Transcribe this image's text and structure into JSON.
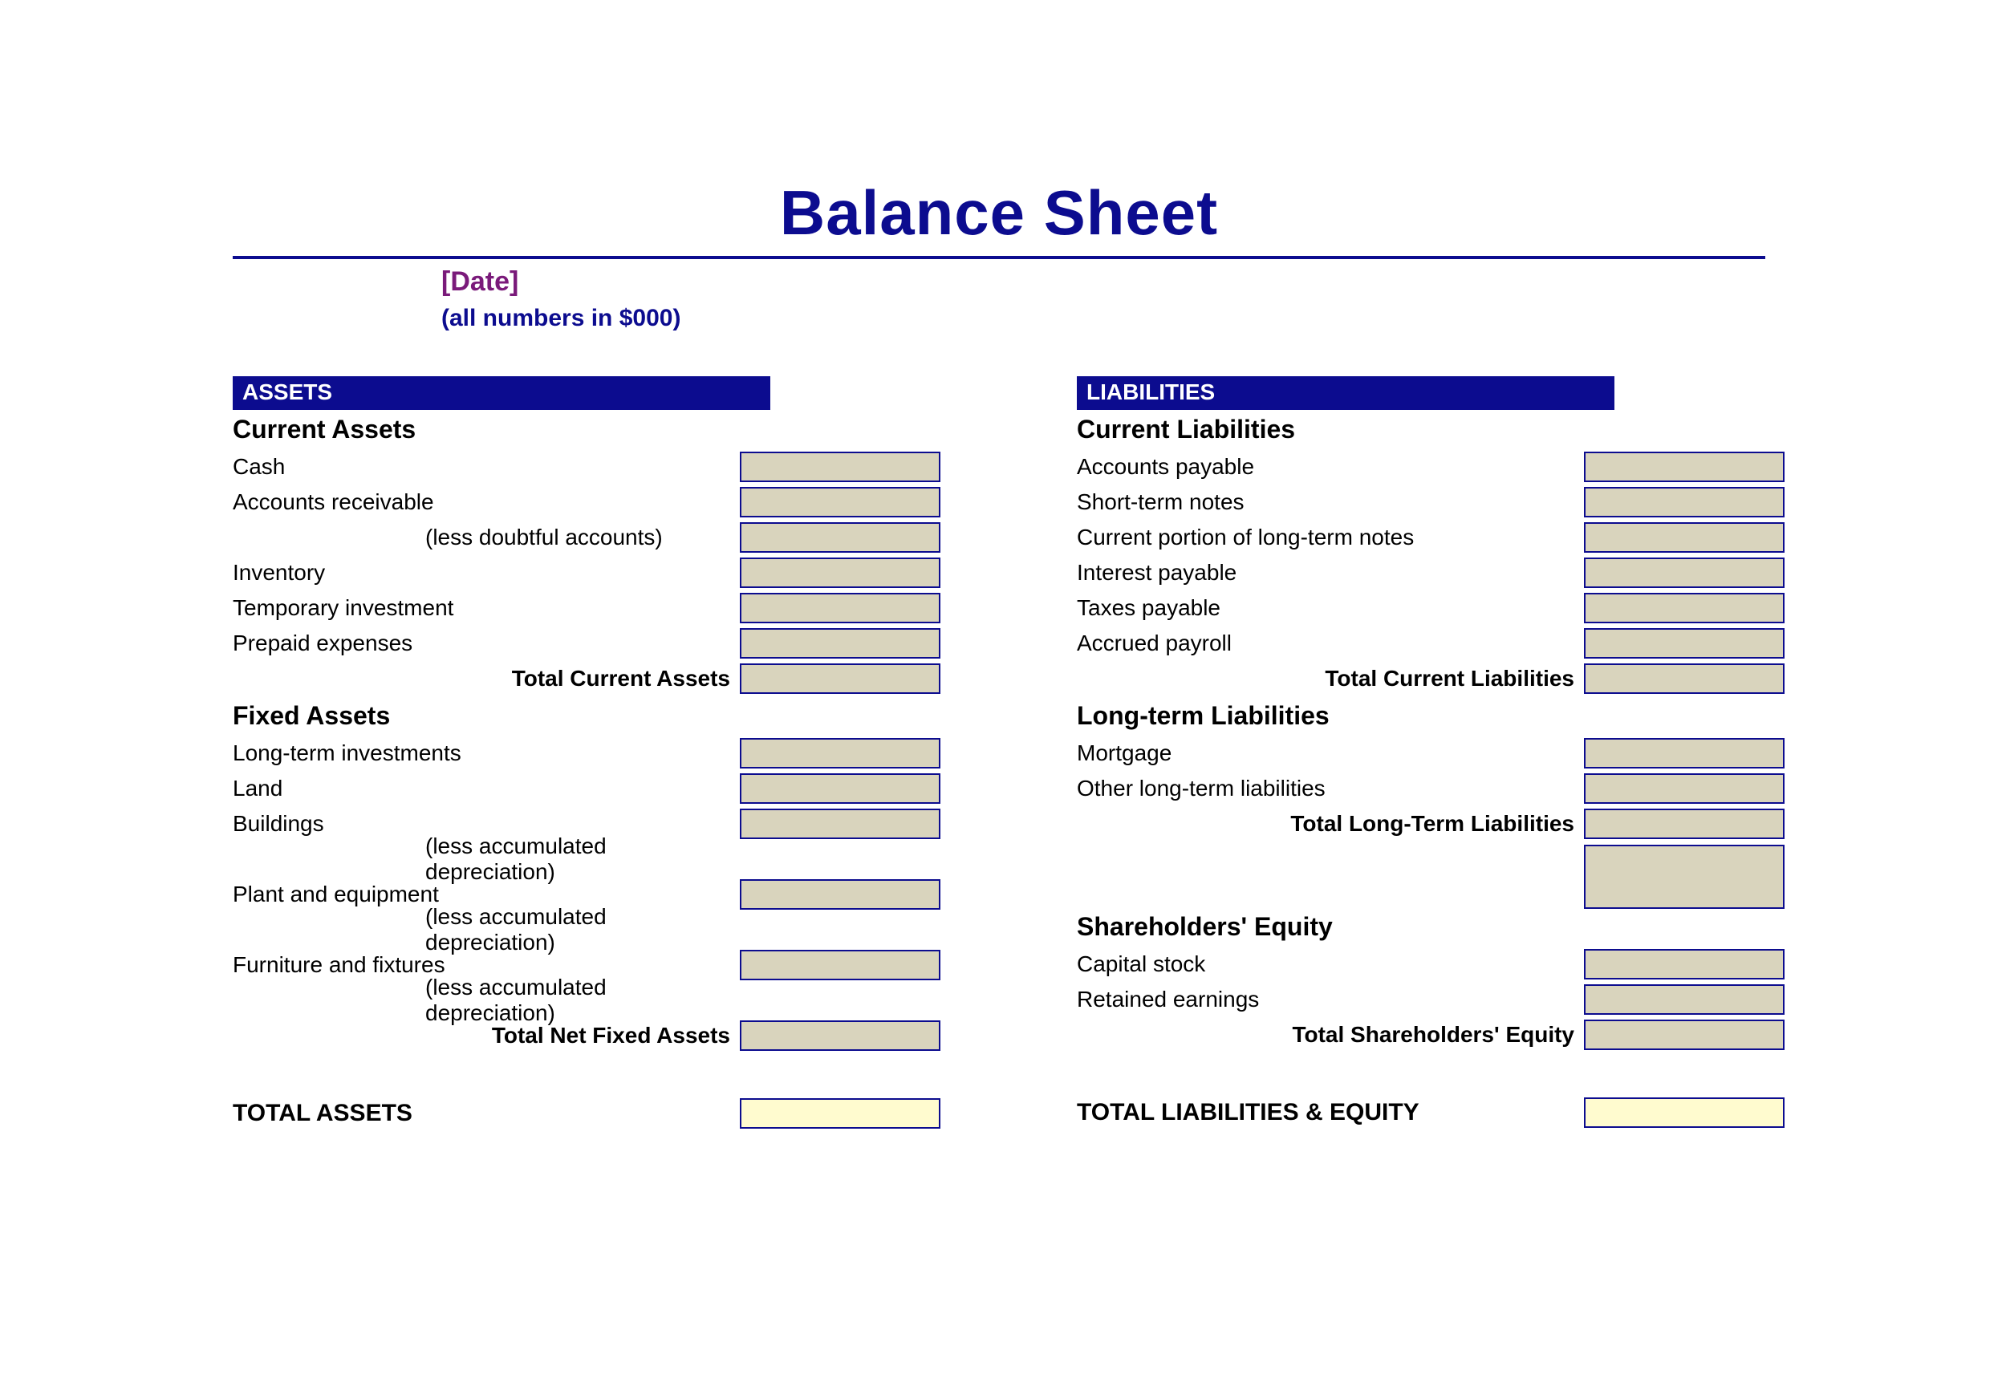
{
  "header": {
    "title": "Balance Sheet",
    "date_placeholder": "[Date]",
    "units": "(all numbers in $000)"
  },
  "assets": {
    "bar": "ASSETS",
    "current_header": "Current Assets",
    "items_current": [
      "Cash",
      "Accounts receivable",
      "(less doubtful accounts)",
      "Inventory",
      "Temporary investment",
      "Prepaid expenses"
    ],
    "total_current": "Total Current Assets",
    "fixed_header": "Fixed Assets",
    "items_fixed": [
      "Long-term investments",
      "Land",
      "Buildings",
      "(less accumulated depreciation)",
      "Plant and equipment",
      "(less accumulated depreciation)",
      "Furniture and fixtures",
      "(less accumulated depreciation)"
    ],
    "total_fixed": "Total Net Fixed Assets",
    "grand_total": "TOTAL ASSETS"
  },
  "liabilities": {
    "bar": "LIABILITIES",
    "current_header": "Current Liabilities",
    "items_current": [
      "Accounts payable",
      "Short-term notes",
      "Current portion of long-term notes",
      "Interest payable",
      "Taxes payable",
      "Accrued payroll"
    ],
    "total_current": "Total Current Liabilities",
    "lt_header": "Long-term Liabilities",
    "items_lt": [
      "Mortgage",
      "Other long-term liabilities"
    ],
    "total_lt": "Total Long-Term Liabilities",
    "equity_header": "Shareholders' Equity",
    "items_equity": [
      "Capital stock",
      "Retained earnings"
    ],
    "total_equity": "Total Shareholders' Equity",
    "grand_total": "TOTAL LIABILITIES & EQUITY"
  }
}
